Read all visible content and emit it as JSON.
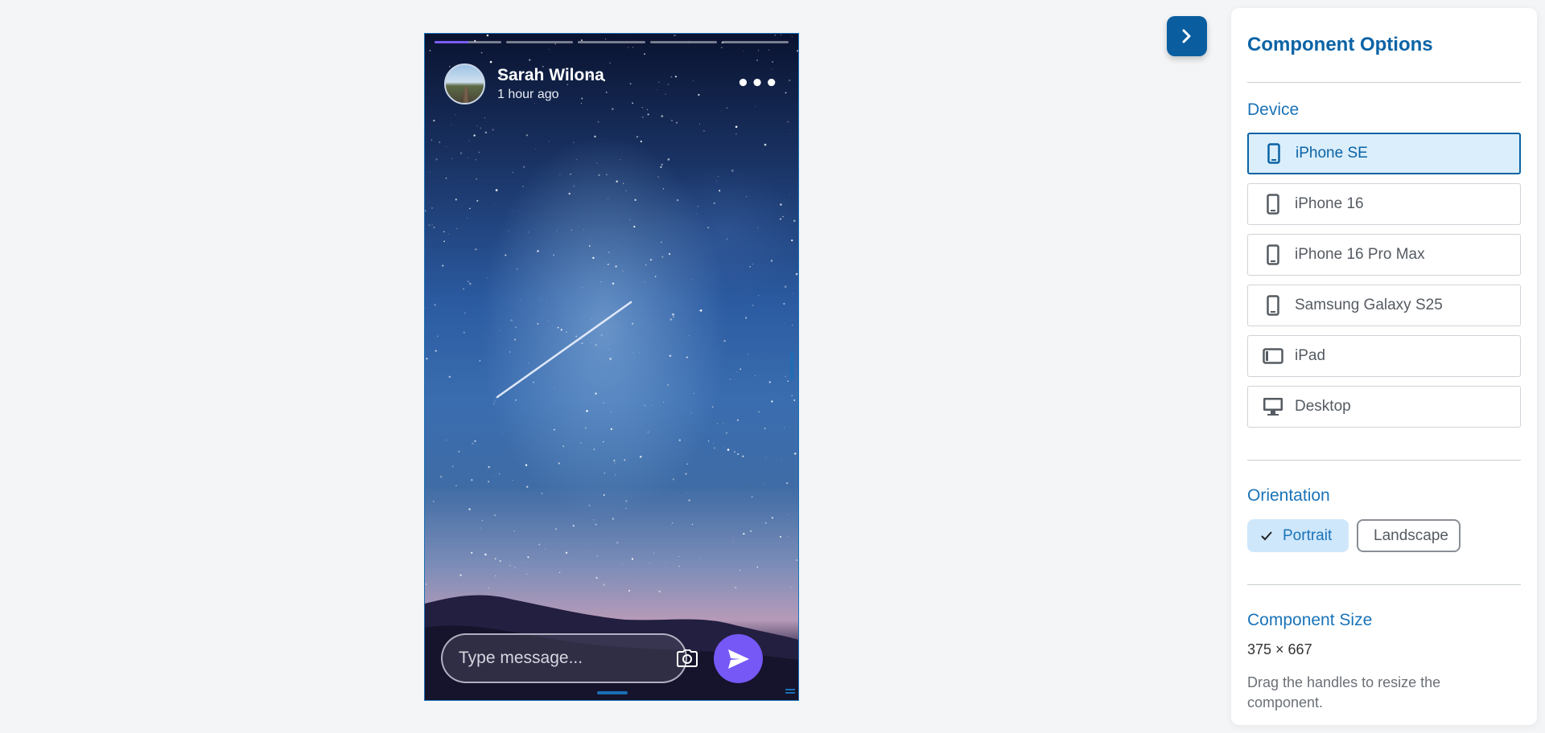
{
  "story": {
    "user_name": "Sarah Wilona",
    "posted_time": "1 hour ago",
    "progress_segments": 5,
    "active_segment_progress": 0.5,
    "message_placeholder": "Type message...",
    "icons": {
      "more": "more-horizontal-icon",
      "camera": "camera-icon",
      "send": "send-icon"
    }
  },
  "toggle": {
    "icon": "chevron-right-icon"
  },
  "panel": {
    "title": "Component Options",
    "device_section": "Device",
    "devices": [
      {
        "label": "iPhone SE",
        "icon": "phone-icon",
        "active": true
      },
      {
        "label": "iPhone 16",
        "icon": "phone-icon",
        "active": false
      },
      {
        "label": "iPhone 16 Pro Max",
        "icon": "phone-icon",
        "active": false
      },
      {
        "label": "Samsung Galaxy S25",
        "icon": "phone-icon",
        "active": false
      },
      {
        "label": "iPad",
        "icon": "tablet-icon",
        "active": false
      },
      {
        "label": "Desktop",
        "icon": "desktop-icon",
        "active": false
      }
    ],
    "orientation_section": "Orientation",
    "orientation": {
      "portrait": "Portrait",
      "landscape": "Landscape",
      "selected": "portrait"
    },
    "size_section": "Component Size",
    "size_value": "375 × 667",
    "size_help": "Drag the handles to resize the component."
  },
  "colors": {
    "accent": "#0b63a5",
    "send": "#7658f7",
    "selected_bg": "#daeefb"
  }
}
